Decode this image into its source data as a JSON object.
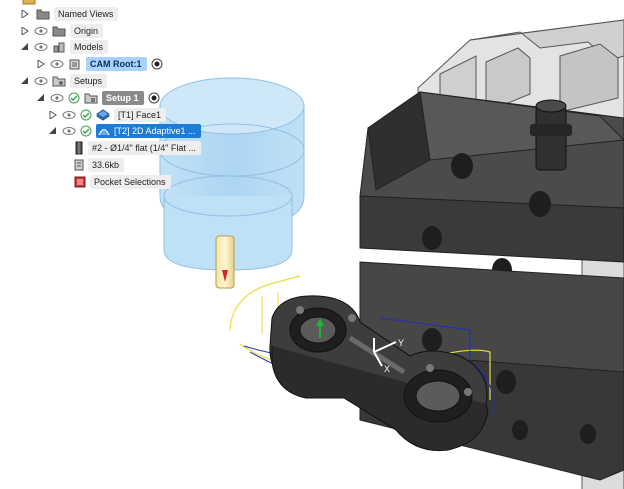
{
  "browser": {
    "items": [
      {
        "label": "Named Views",
        "icon": "folder-icon"
      },
      {
        "label": "Origin",
        "icon": "folder-icon"
      },
      {
        "label": "Models",
        "icon": "models-icon"
      },
      {
        "label": "CAM Root:1",
        "icon": "component-icon"
      },
      {
        "label": "Setups",
        "icon": "setups-icon"
      },
      {
        "label": "Setup 1",
        "icon": "setup-icon"
      },
      {
        "label": "[T1] Face1",
        "icon": "face-op-icon"
      },
      {
        "label": "[T2] 2D Adaptive1 ...",
        "icon": "adaptive-op-icon"
      },
      {
        "label": "#2 - Ø1/4\" flat (1/4\" Flat ...",
        "icon": "tool-icon"
      },
      {
        "label": "33.6kb",
        "icon": "nc-size-icon"
      },
      {
        "label": "Pocket Selections",
        "icon": "selection-icon"
      }
    ]
  },
  "triad": {
    "x": "X",
    "y": "Y"
  },
  "colors": {
    "selection": "#1f7bd8",
    "model_highlight": "#a9d3ff",
    "stock": "#9fd0f2",
    "toolpath": "#1c2fb8",
    "linking": "#e8de3a",
    "tool_tip": "#e02020"
  }
}
